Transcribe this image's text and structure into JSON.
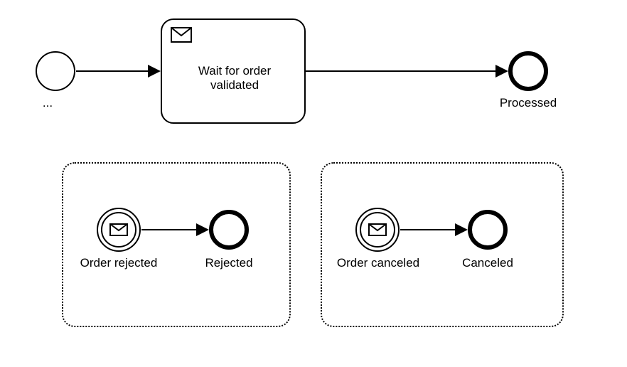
{
  "start_label": "...",
  "task1_label": "Wait for order\nvalidated",
  "end_main_label": "Processed",
  "sub1": {
    "start_label": "Order rejected",
    "end_label": "Rejected"
  },
  "sub2": {
    "start_label": "Order canceled",
    "end_label": "Canceled"
  },
  "icons": {
    "envelope": "message-icon"
  }
}
